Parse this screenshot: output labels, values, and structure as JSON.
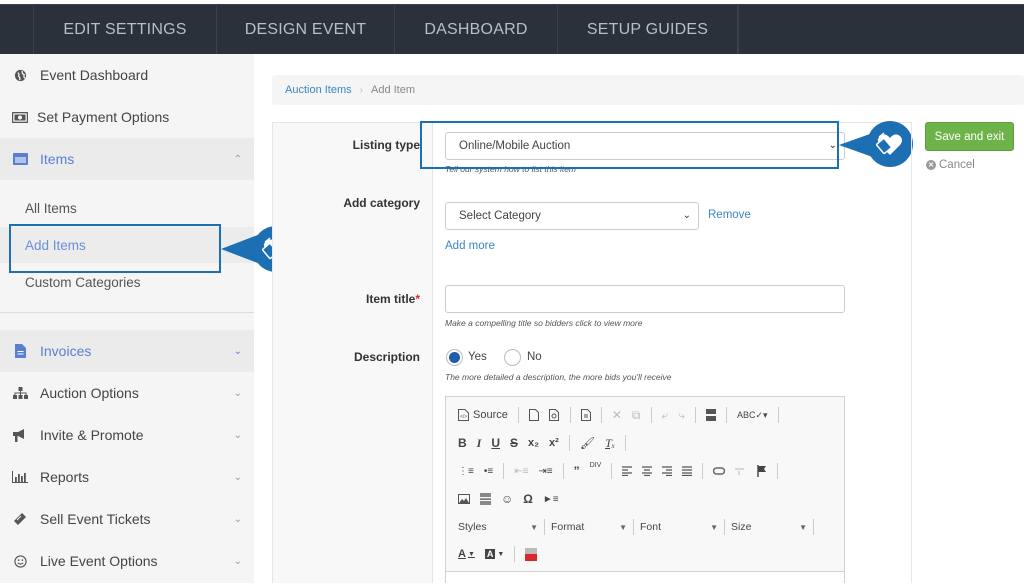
{
  "topnav": {
    "tabs": [
      {
        "label": "EDIT SETTINGS"
      },
      {
        "label": "DESIGN EVENT"
      },
      {
        "label": "DASHBOARD"
      },
      {
        "label": "SETUP GUIDES"
      }
    ]
  },
  "sidebar": {
    "items": [
      {
        "label": "Event Dashboard",
        "icon": "globe-icon"
      },
      {
        "label": "Set Payment Options",
        "icon": "money-icon"
      },
      {
        "label": "Items",
        "icon": "list-window-icon",
        "expanded": true
      },
      {
        "label": "Invoices",
        "icon": "document-icon"
      },
      {
        "label": "Auction Options",
        "icon": "sitemap-icon"
      },
      {
        "label": "Invite & Promote",
        "icon": "megaphone-icon"
      },
      {
        "label": "Reports",
        "icon": "bar-chart-icon"
      },
      {
        "label": "Sell Event Tickets",
        "icon": "ticket-icon"
      },
      {
        "label": "Live Event Options",
        "icon": "smiley-icon"
      }
    ],
    "subitems": [
      {
        "label": "All Items"
      },
      {
        "label": "Add Items",
        "active": true
      },
      {
        "label": "Custom Categories"
      }
    ]
  },
  "breadcrumb": {
    "parent": "Auction Items",
    "separator": "›",
    "current": "Add Item"
  },
  "form": {
    "listing_type": {
      "label": "Listing type",
      "value": "Online/Mobile Auction",
      "help": "Tell our system how to list this item"
    },
    "category": {
      "label": "Add category",
      "value": "Select Category",
      "remove_label": "Remove",
      "add_more_label": "Add more"
    },
    "item_title": {
      "label": "Item title",
      "required_mark": "*",
      "value": "",
      "help": "Make a compelling title so bidders click to view more"
    },
    "description": {
      "label": "Description",
      "options": [
        {
          "label": "Yes",
          "selected": true
        },
        {
          "label": "No",
          "selected": false
        }
      ],
      "help": "The more detailed a description, the more bids you'll receive"
    }
  },
  "editor": {
    "source_label": "Source",
    "combos": [
      {
        "label": "Styles"
      },
      {
        "label": "Format"
      },
      {
        "label": "Font"
      },
      {
        "label": "Size"
      }
    ]
  },
  "actions": {
    "save_label": "Save and exit",
    "cancel_label": "Cancel"
  },
  "colors": {
    "accent_blue": "#1d6fb4",
    "link_blue": "#3a86c8",
    "save_green": "#6db34a",
    "nav_dark": "#2b313b"
  }
}
